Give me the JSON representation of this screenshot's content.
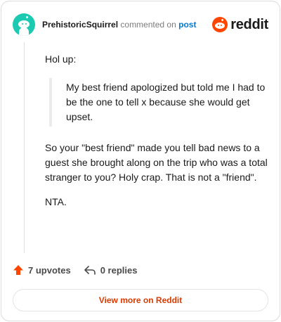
{
  "header": {
    "username": "PrehistoricSquirrel",
    "action_text": "commented on",
    "post_link": "post",
    "brand_name": "reddit"
  },
  "comment": {
    "intro": "Hol up:",
    "quote": "My best friend apologized but told me I had to be the one to tell x because she would get upset.",
    "body": "So your \"best friend\" made you tell bad news to a guest she brought along on the trip who was a total stranger to you? Holy crap. That is not a \"friend\".",
    "verdict": "NTA."
  },
  "footer": {
    "upvotes": "7 upvotes",
    "replies": "0 replies"
  },
  "view_more_label": "View more on Reddit",
  "colors": {
    "brand": "#ff4500",
    "avatar": "#1cc9b1",
    "link": "#0079d3",
    "view_more_text": "#d93a00"
  },
  "icons": [
    "avatar",
    "reddit-logo-icon",
    "upvote-arrow-icon",
    "reply-icon"
  ]
}
